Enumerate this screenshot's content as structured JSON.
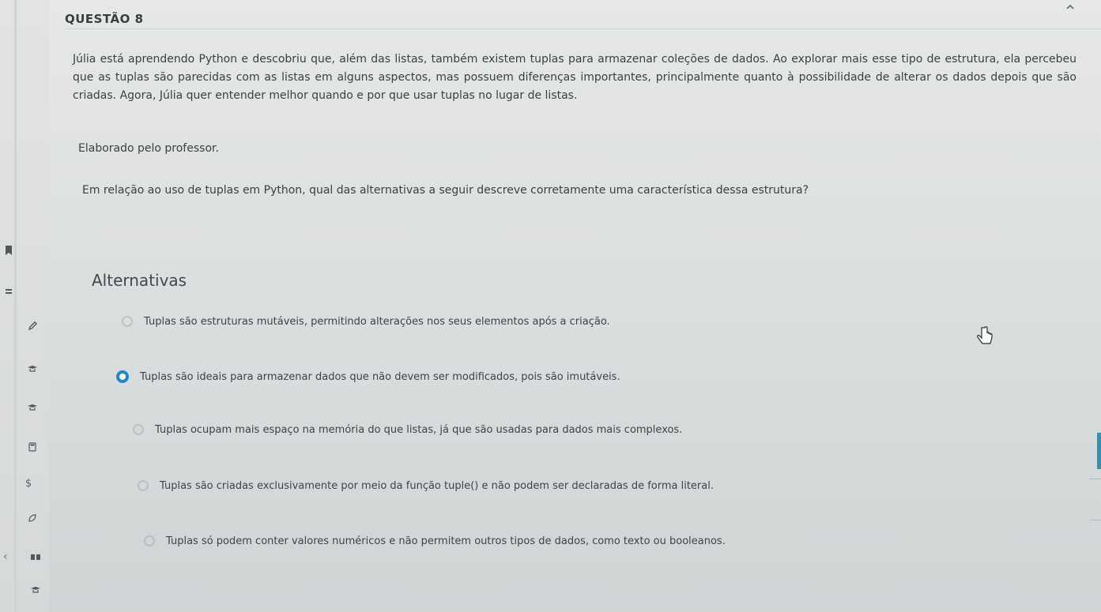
{
  "question": {
    "title": "QUESTÃO 8",
    "collapse_icon": "chevron-up-icon",
    "statement": "Júlia está aprendendo Python e descobriu que, além das listas, também existem tuplas para armazenar coleções de dados. Ao explorar mais esse tipo de estrutura, ela percebeu que as tuplas são parecidas com as listas em alguns aspectos, mas possuem diferenças importantes, principalmente quanto à possibilidade de alterar os dados depois que são criadas. Agora, Júlia quer entender melhor quando e por que usar tuplas no lugar de listas.",
    "source": "Elaborado pelo professor.",
    "prompt": "Em relação ao uso de tuplas em Python, qual das alternativas a seguir descreve corretamente uma característica dessa estrutura?"
  },
  "alternatives": {
    "heading": "Alternativas",
    "options": [
      {
        "text": "Tuplas são estruturas mutáveis, permitindo alterações nos seus elementos após a criação.",
        "selected": false
      },
      {
        "text": "Tuplas são ideais para armazenar dados que não devem ser modificados, pois são imutáveis.",
        "selected": true
      },
      {
        "text": "Tuplas ocupam mais espaço na memória do que listas, já que são usadas para dados mais complexos.",
        "selected": false
      },
      {
        "text": "Tuplas são criadas exclusivamente por meio da função tuple() e não podem ser declaradas de forma literal.",
        "selected": false
      },
      {
        "text": "Tuplas só podem conter valores numéricos e não permitem outros tipos de dados, como texto ou booleanos.",
        "selected": false
      }
    ]
  },
  "sidebar": {
    "icons": [
      "bookmark-icon",
      "stack-icon",
      "pencil-icon",
      "graduation-cap-icon",
      "graduation-cap-icon",
      "calculator-icon",
      "dollar-icon",
      "leaf-icon",
      "book-icon",
      "graduation-cap-icon"
    ],
    "dollar_glyph": "$"
  },
  "colors": {
    "accent": "#1f87c8",
    "edge_accent": "#3c8fa9"
  }
}
